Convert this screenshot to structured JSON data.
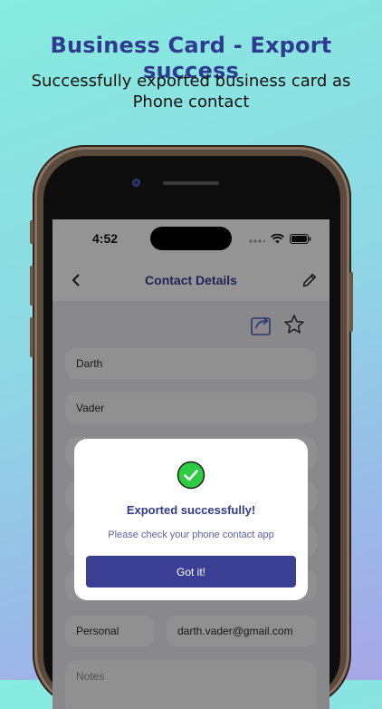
{
  "banner": {
    "headline": "Business Card - Export success",
    "subline_line1": "Successfully exported business card as",
    "subline_line2": "Phone contact"
  },
  "status_bar": {
    "time": "4:52",
    "icons": [
      "signal-dots-icon",
      "wifi-icon",
      "battery-icon"
    ]
  },
  "nav": {
    "title": "Contact Details",
    "back_icon": "chevron-left-icon",
    "edit_icon": "pencil-icon"
  },
  "actions": {
    "share_icon": "share-export-icon",
    "favorite_icon": "star-outline-icon"
  },
  "fields": {
    "first_name": "Darth",
    "last_name": "Vader",
    "email_type": "Personal",
    "email": "darth.vader@gmail.com",
    "notes_placeholder": "Notes"
  },
  "modal": {
    "icon": "check-circle-icon",
    "title": "Exported successfully!",
    "message": "Please check your phone contact app",
    "button_label": "Got it!"
  },
  "colors": {
    "accent": "#3a3f93",
    "success": "#2ecc40",
    "banner_title": "#2f3b8f"
  }
}
